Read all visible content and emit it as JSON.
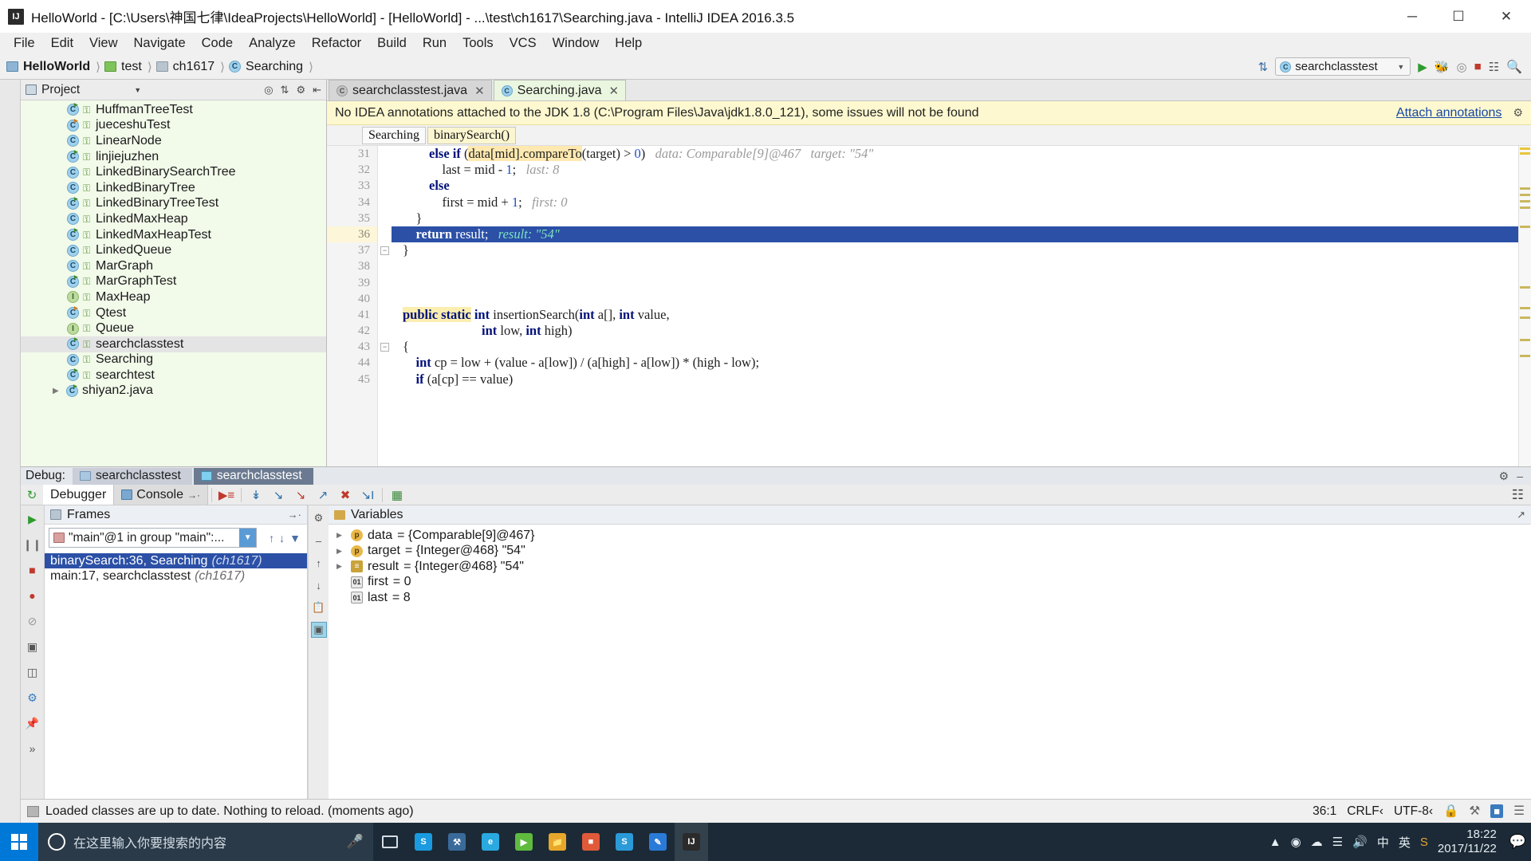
{
  "window": {
    "title": "HelloWorld - [C:\\Users\\神国七律\\IdeaProjects\\HelloWorld] - [HelloWorld] - ...\\test\\ch1617\\Searching.java - IntelliJ IDEA 2016.3.5",
    "app_icon": "IJ",
    "minimize": "─",
    "maximize": "☐",
    "close": "✕"
  },
  "menu": [
    "File",
    "Edit",
    "View",
    "Navigate",
    "Code",
    "Analyze",
    "Refactor",
    "Build",
    "Run",
    "Tools",
    "VCS",
    "Window",
    "Help"
  ],
  "navbar": {
    "crumbs": [
      {
        "label": "HelloWorld",
        "icon": "module-icon",
        "bold": true
      },
      {
        "label": "test",
        "icon": "folder-icon",
        "bold": false
      },
      {
        "label": "ch1617",
        "icon": "package-icon",
        "bold": false
      },
      {
        "label": "Searching",
        "icon": "class-icon",
        "bold": false
      }
    ],
    "run_config": "searchclasstest",
    "actions": [
      "sync-icon",
      "run-icon",
      "debug-icon",
      "coverage-icon",
      "stop-icon",
      "layout-icon",
      "search-icon"
    ]
  },
  "project_panel": {
    "title": "Project",
    "header_icons": [
      "locate-icon",
      "collapse-icon",
      "settings-icon",
      "hide-icon"
    ],
    "items": [
      {
        "label": "HuffmanTreeTest",
        "type": "class",
        "runnable": true
      },
      {
        "label": "jueceshuTest",
        "type": "class",
        "runnable": true
      },
      {
        "label": "LinearNode",
        "type": "class",
        "runnable": false
      },
      {
        "label": "linjiejuzhen",
        "type": "class",
        "runnable": true
      },
      {
        "label": "LinkedBinarySearchTree",
        "type": "class",
        "runnable": false
      },
      {
        "label": "LinkedBinaryTree",
        "type": "class",
        "runnable": false
      },
      {
        "label": "LinkedBinaryTreeTest",
        "type": "class",
        "runnable": true
      },
      {
        "label": "LinkedMaxHeap",
        "type": "class",
        "runnable": false
      },
      {
        "label": "LinkedMaxHeapTest",
        "type": "class",
        "runnable": true
      },
      {
        "label": "LinkedQueue",
        "type": "class",
        "runnable": false
      },
      {
        "label": "MarGraph",
        "type": "class",
        "runnable": false
      },
      {
        "label": "MarGraphTest",
        "type": "class",
        "runnable": true
      },
      {
        "label": "MaxHeap",
        "type": "interface",
        "runnable": false
      },
      {
        "label": "Qtest",
        "type": "class",
        "runnable": true
      },
      {
        "label": "Queue",
        "type": "interface",
        "runnable": false
      },
      {
        "label": "searchclasstest",
        "type": "class",
        "runnable": true,
        "selected": true
      },
      {
        "label": "Searching",
        "type": "class",
        "runnable": false
      },
      {
        "label": "searchtest",
        "type": "class",
        "runnable": true
      },
      {
        "label": "shiyan2.java",
        "type": "file",
        "runnable": true,
        "expandable": true
      }
    ]
  },
  "editor": {
    "tabs": [
      {
        "label": "searchclasstest.java",
        "active": false,
        "close": "✕"
      },
      {
        "label": "Searching.java",
        "active": true,
        "close": "✕"
      }
    ],
    "notification": {
      "text": "No IDEA annotations attached to the JDK 1.8 (C:\\Program Files\\Java\\jdk1.8.0_121), some issues will not be found",
      "action": "Attach annotations",
      "gear": "⚙"
    },
    "method_crumbs": [
      {
        "label": "Searching",
        "highlighted": false
      },
      {
        "label": "binarySearch()",
        "highlighted": true
      }
    ],
    "lines": [
      {
        "no": "31",
        "indent": 8,
        "segments": [
          {
            "t": "else if ",
            "c": "kw"
          },
          {
            "t": "(",
            "c": "plain"
          },
          {
            "t": "data[mid].compareTo",
            "c": "mark-orange"
          },
          {
            "t": "(target) > ",
            "c": "plain"
          },
          {
            "t": "0",
            "c": "num"
          },
          {
            "t": ")",
            "c": "plain"
          },
          {
            "t": "   data: Comparable[9]@467   target: \"54\"",
            "c": "hint"
          }
        ]
      },
      {
        "no": "32",
        "indent": 12,
        "segments": [
          {
            "t": "last = mid - ",
            "c": "plain"
          },
          {
            "t": "1",
            "c": "num"
          },
          {
            "t": ";",
            "c": "plain"
          },
          {
            "t": "   last: 8",
            "c": "hint"
          }
        ]
      },
      {
        "no": "33",
        "indent": 8,
        "segments": [
          {
            "t": "else",
            "c": "kw"
          }
        ]
      },
      {
        "no": "34",
        "indent": 12,
        "segments": [
          {
            "t": "first = mid + ",
            "c": "plain"
          },
          {
            "t": "1",
            "c": "num"
          },
          {
            "t": ";",
            "c": "plain"
          },
          {
            "t": "   first: 0",
            "c": "hint"
          }
        ]
      },
      {
        "no": "35",
        "indent": 4,
        "segments": [
          {
            "t": "}",
            "c": "plain"
          }
        ]
      },
      {
        "no": "36",
        "indent": 4,
        "highlight": true,
        "segments": [
          {
            "t": "return",
            "c": "kw"
          },
          {
            "t": " result;",
            "c": "plain"
          },
          {
            "t": "   result: \"54\"",
            "c": "hint"
          }
        ]
      },
      {
        "no": "37",
        "indent": 0,
        "fold": true,
        "segments": [
          {
            "t": "}",
            "c": "plain"
          }
        ]
      },
      {
        "no": "38",
        "indent": 0,
        "segments": []
      },
      {
        "no": "39",
        "indent": 0,
        "segments": []
      },
      {
        "no": "40",
        "indent": 0,
        "segments": []
      },
      {
        "no": "41",
        "indent": 0,
        "segments": [
          {
            "t": "public static",
            "c": "kw mark-yellow"
          },
          {
            "t": " ",
            "c": "plain"
          },
          {
            "t": "int",
            "c": "kw"
          },
          {
            "t": " insertionSearch(",
            "c": "plain"
          },
          {
            "t": "int",
            "c": "kw"
          },
          {
            "t": " a[], ",
            "c": "plain"
          },
          {
            "t": "int",
            "c": "kw"
          },
          {
            "t": " value,",
            "c": "plain"
          }
        ]
      },
      {
        "no": "42",
        "indent": 24,
        "segments": [
          {
            "t": "int",
            "c": "kw"
          },
          {
            "t": " low, ",
            "c": "plain"
          },
          {
            "t": "int",
            "c": "kw"
          },
          {
            "t": " high)",
            "c": "plain"
          }
        ]
      },
      {
        "no": "43",
        "indent": 0,
        "fold": true,
        "segments": [
          {
            "t": "{",
            "c": "plain"
          }
        ]
      },
      {
        "no": "44",
        "indent": 4,
        "segments": [
          {
            "t": "int",
            "c": "kw"
          },
          {
            "t": " cp = low + (value - a[low]) / (a[high] - a[low]) * (high - low);",
            "c": "plain"
          }
        ]
      },
      {
        "no": "45",
        "indent": 4,
        "segments": [
          {
            "t": "if",
            "c": "kw"
          },
          {
            "t": " (a[cp] == value)",
            "c": "plain"
          }
        ]
      }
    ]
  },
  "debug": {
    "label": "Debug:",
    "sessions": [
      {
        "label": "searchclasstest",
        "active": false
      },
      {
        "label": "searchclasstest",
        "active": true
      }
    ],
    "tabs": [
      {
        "label": "Debugger",
        "active": true,
        "icon": "debugger-icon"
      },
      {
        "label": "Console",
        "active": false,
        "icon": "console-icon"
      }
    ],
    "toolbar_icons": [
      "rerun-icon",
      "show-execution-point-icon",
      "step-over-icon",
      "step-into-icon",
      "force-step-into-icon",
      "step-out-icon",
      "drop-frame-icon",
      "run-to-cursor-icon",
      "evaluate-expression-icon"
    ],
    "side_icons": [
      "resume-icon",
      "pause-icon",
      "stop-icon",
      "view-breakpoints-icon",
      "mute-breakpoints-icon",
      "settings-icon",
      "layout-icon",
      "settings2-icon",
      "pin-icon",
      "more-icon"
    ],
    "frames": {
      "title": "Frames",
      "thread": "\"main\"@1 in group \"main\":...",
      "rows": [
        {
          "label": "binarySearch:36, Searching",
          "meta": "(ch1617)",
          "selected": true
        },
        {
          "label": "main:17, searchclasstest",
          "meta": "(ch1617)",
          "selected": false
        }
      ]
    },
    "variables": {
      "title": "Variables",
      "rows": [
        {
          "expandable": true,
          "kind": "param",
          "name": "data",
          "value": "= {Comparable[9]@467}"
        },
        {
          "expandable": true,
          "kind": "param",
          "name": "target",
          "value": "= {Integer@468} \"54\""
        },
        {
          "expandable": true,
          "kind": "list",
          "name": "result",
          "value": "= {Integer@468} \"54\""
        },
        {
          "expandable": false,
          "kind": "primitive",
          "name": "first",
          "value": "= 0"
        },
        {
          "expandable": false,
          "kind": "primitive",
          "name": "last",
          "value": "= 8"
        }
      ]
    }
  },
  "statusbar": {
    "message": "Loaded classes are up to date. Nothing to reload. (moments ago)",
    "position": "36:1",
    "line_sep": "CRLF‹",
    "encoding": "UTF-8‹",
    "icons": [
      "lock-icon",
      "branch-icon",
      "memory-icon",
      "notify-icon"
    ]
  },
  "taskbar": {
    "search_placeholder": "在这里输入你要搜索的内容",
    "apps": [
      "cortana-icon",
      "mic-icon",
      "taskview-icon",
      "store-icon",
      "tool-icon",
      "edge-icon",
      "android-icon",
      "explorer-icon",
      "photos-icon",
      "skype-icon",
      "editor-icon",
      "intellij-icon"
    ],
    "tray": [
      "chevron-up-icon",
      "record-icon",
      "cloud-icon",
      "network-icon",
      "volume-icon",
      "ime-icon",
      "lang-icon",
      "sogou-icon"
    ],
    "time": "18:22",
    "date": "2017/11/22",
    "notification": "notification-icon"
  }
}
